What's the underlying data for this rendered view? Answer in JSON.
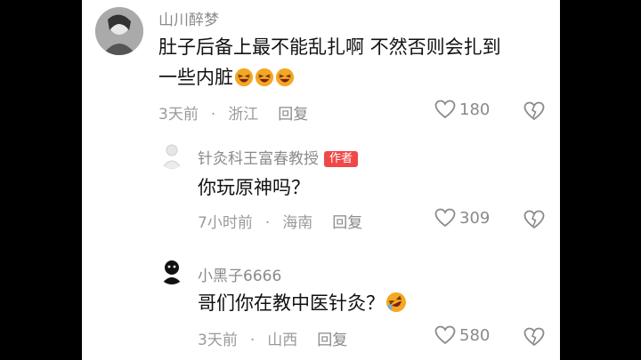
{
  "comments": [
    {
      "username": "山川醉梦",
      "line1": "肚子后备上最不能乱扎啊 不然否则会扎到",
      "line2": "一些内脏",
      "time": "3天前",
      "location": "浙江",
      "reply": "回复",
      "likes": "180"
    },
    {
      "username": "针灸科王富春教授",
      "author_tag": "作者",
      "text": "你玩原神吗？",
      "time": "7小时前",
      "location": "海南",
      "reply": "回复",
      "likes": "309"
    },
    {
      "username": "小黑子6666",
      "text": "哥们你在教中医针灸？",
      "time": "3天前",
      "location": "山西",
      "reply": "回复",
      "likes": "580"
    }
  ],
  "icons": {
    "like": "heart-outline-icon",
    "dislike": "broken-heart-icon",
    "emoji_1": "grinning-squint-emoji",
    "emoji_2": "rolling-laughing-emoji"
  },
  "colors": {
    "author_tag": "#f04848",
    "emoji": "#f5a623"
  }
}
